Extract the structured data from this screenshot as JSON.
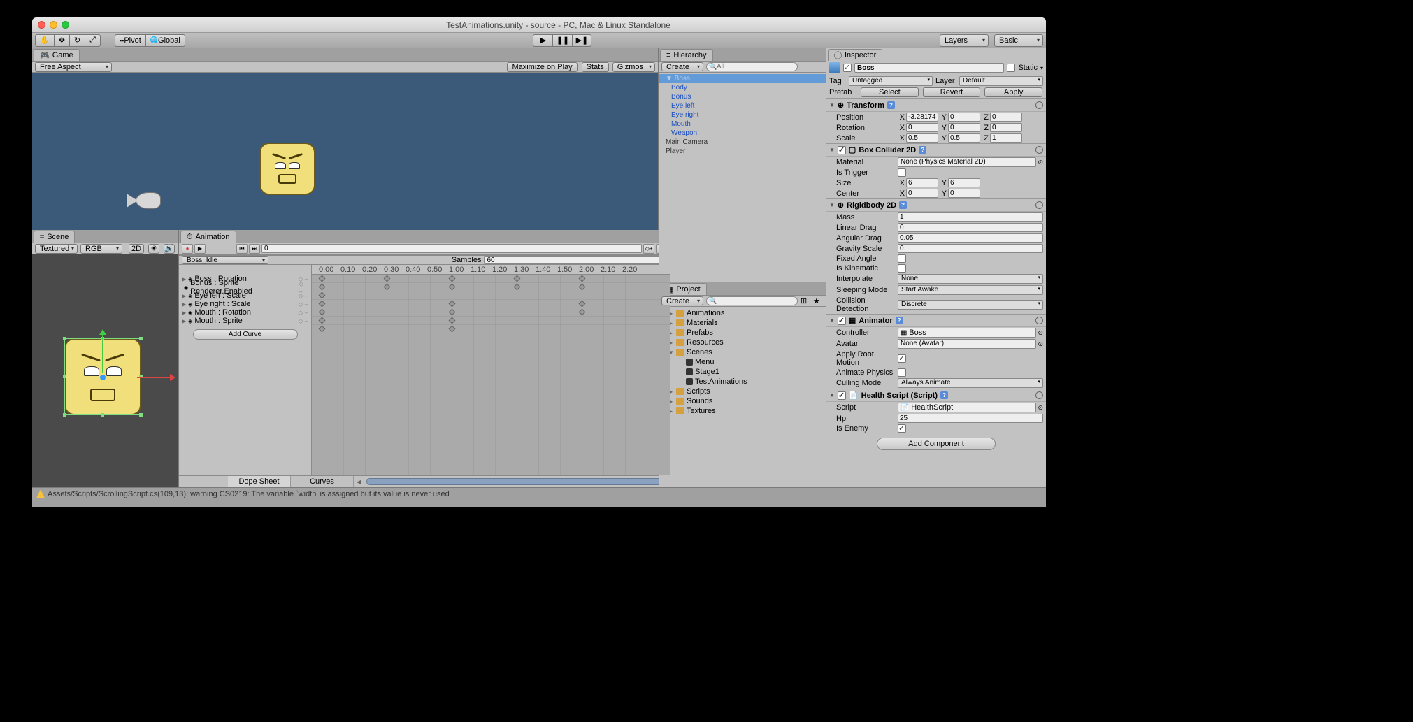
{
  "titlebar": {
    "title": "TestAnimations.unity - source - PC, Mac & Linux Standalone"
  },
  "toolbar": {
    "pivot": "Pivot",
    "global": "Global",
    "layers": "Layers",
    "layout": "Basic"
  },
  "game": {
    "tab": "Game",
    "aspect": "Free Aspect",
    "maximize": "Maximize on Play",
    "stats": "Stats",
    "gizmos": "Gizmos"
  },
  "scene": {
    "tab": "Scene",
    "shading": "Textured",
    "renderMode": "RGB",
    "dim": "2D"
  },
  "animation": {
    "tab": "Animation",
    "clip": "Boss_Idle",
    "samplesLabel": "Samples",
    "samples": "60",
    "frame": "0",
    "tracks": [
      "Boss : Rotation",
      "Bonus : Sprite Renderer.Enabled",
      "Eye left : Scale",
      "Eye right : Scale",
      "Mouth : Rotation",
      "Mouth : Sprite"
    ],
    "addCurve": "Add Curve",
    "dopeSheet": "Dope Sheet",
    "curves": "Curves",
    "times": [
      "0:00",
      "0:10",
      "0:20",
      "0:30",
      "0:40",
      "0:50",
      "1:00",
      "1:10",
      "1:20",
      "1:30",
      "1:40",
      "1:50",
      "2:00",
      "2:10",
      "2:20"
    ]
  },
  "hierarchy": {
    "tab": "Hierarchy",
    "create": "Create",
    "search": "All",
    "items": [
      {
        "name": "Boss",
        "sel": true
      },
      {
        "name": "Body"
      },
      {
        "name": "Bonus"
      },
      {
        "name": "Eye left"
      },
      {
        "name": "Eye right"
      },
      {
        "name": "Mouth"
      },
      {
        "name": "Weapon"
      },
      {
        "name": "Main Camera",
        "top": true
      },
      {
        "name": "Player",
        "top": true
      }
    ]
  },
  "project": {
    "tab": "Project",
    "create": "Create",
    "items": [
      {
        "name": "Animations",
        "type": "folder"
      },
      {
        "name": "Materials",
        "type": "folder"
      },
      {
        "name": "Prefabs",
        "type": "folder"
      },
      {
        "name": "Resources",
        "type": "folder"
      },
      {
        "name": "Scenes",
        "type": "folder",
        "open": true
      },
      {
        "name": "Menu",
        "type": "scene",
        "child": true
      },
      {
        "name": "Stage1",
        "type": "scene",
        "child": true
      },
      {
        "name": "TestAnimations",
        "type": "scene",
        "child": true
      },
      {
        "name": "Scripts",
        "type": "folder"
      },
      {
        "name": "Sounds",
        "type": "folder"
      },
      {
        "name": "Textures",
        "type": "folder"
      }
    ]
  },
  "inspector": {
    "tab": "Inspector",
    "name": "Boss",
    "static": "Static",
    "tagLabel": "Tag",
    "tag": "Untagged",
    "layerLabel": "Layer",
    "layer": "Default",
    "prefabLabel": "Prefab",
    "select": "Select",
    "revert": "Revert",
    "apply": "Apply",
    "transform": {
      "title": "Transform",
      "position": {
        "label": "Position",
        "x": "-3.281749",
        "y": "0",
        "z": "0"
      },
      "rotation": {
        "label": "Rotation",
        "x": "0",
        "y": "0",
        "z": "0"
      },
      "scale": {
        "label": "Scale",
        "x": "0.5",
        "y": "0.5",
        "z": "1"
      }
    },
    "boxCollider": {
      "title": "Box Collider 2D",
      "material": {
        "label": "Material",
        "value": "None (Physics Material 2D)"
      },
      "isTrigger": "Is Trigger",
      "size": {
        "label": "Size",
        "x": "6",
        "y": "6"
      },
      "center": {
        "label": "Center",
        "x": "0",
        "y": "0"
      }
    },
    "rigidbody": {
      "title": "Rigidbody 2D",
      "mass": {
        "label": "Mass",
        "value": "1"
      },
      "linearDrag": {
        "label": "Linear Drag",
        "value": "0"
      },
      "angularDrag": {
        "label": "Angular Drag",
        "value": "0.05"
      },
      "gravityScale": {
        "label": "Gravity Scale",
        "value": "0"
      },
      "fixedAngle": "Fixed Angle",
      "isKinematic": "Is Kinematic",
      "interpolate": {
        "label": "Interpolate",
        "value": "None"
      },
      "sleepingMode": {
        "label": "Sleeping Mode",
        "value": "Start Awake"
      },
      "collision": {
        "label": "Collision Detection",
        "value": "Discrete"
      }
    },
    "animator": {
      "title": "Animator",
      "controller": {
        "label": "Controller",
        "value": "Boss"
      },
      "avatar": {
        "label": "Avatar",
        "value": "None (Avatar)"
      },
      "applyRoot": "Apply Root Motion",
      "animatePhysics": "Animate Physics",
      "culling": {
        "label": "Culling Mode",
        "value": "Always Animate"
      }
    },
    "health": {
      "title": "Health Script (Script)",
      "script": {
        "label": "Script",
        "value": "HealthScript"
      },
      "hp": {
        "label": "Hp",
        "value": "25"
      },
      "isEnemy": "Is Enemy"
    },
    "addComponent": "Add Component"
  },
  "status": "Assets/Scripts/ScrollingScript.cs(109,13): warning CS0219: The variable `width' is assigned but its value is never used"
}
